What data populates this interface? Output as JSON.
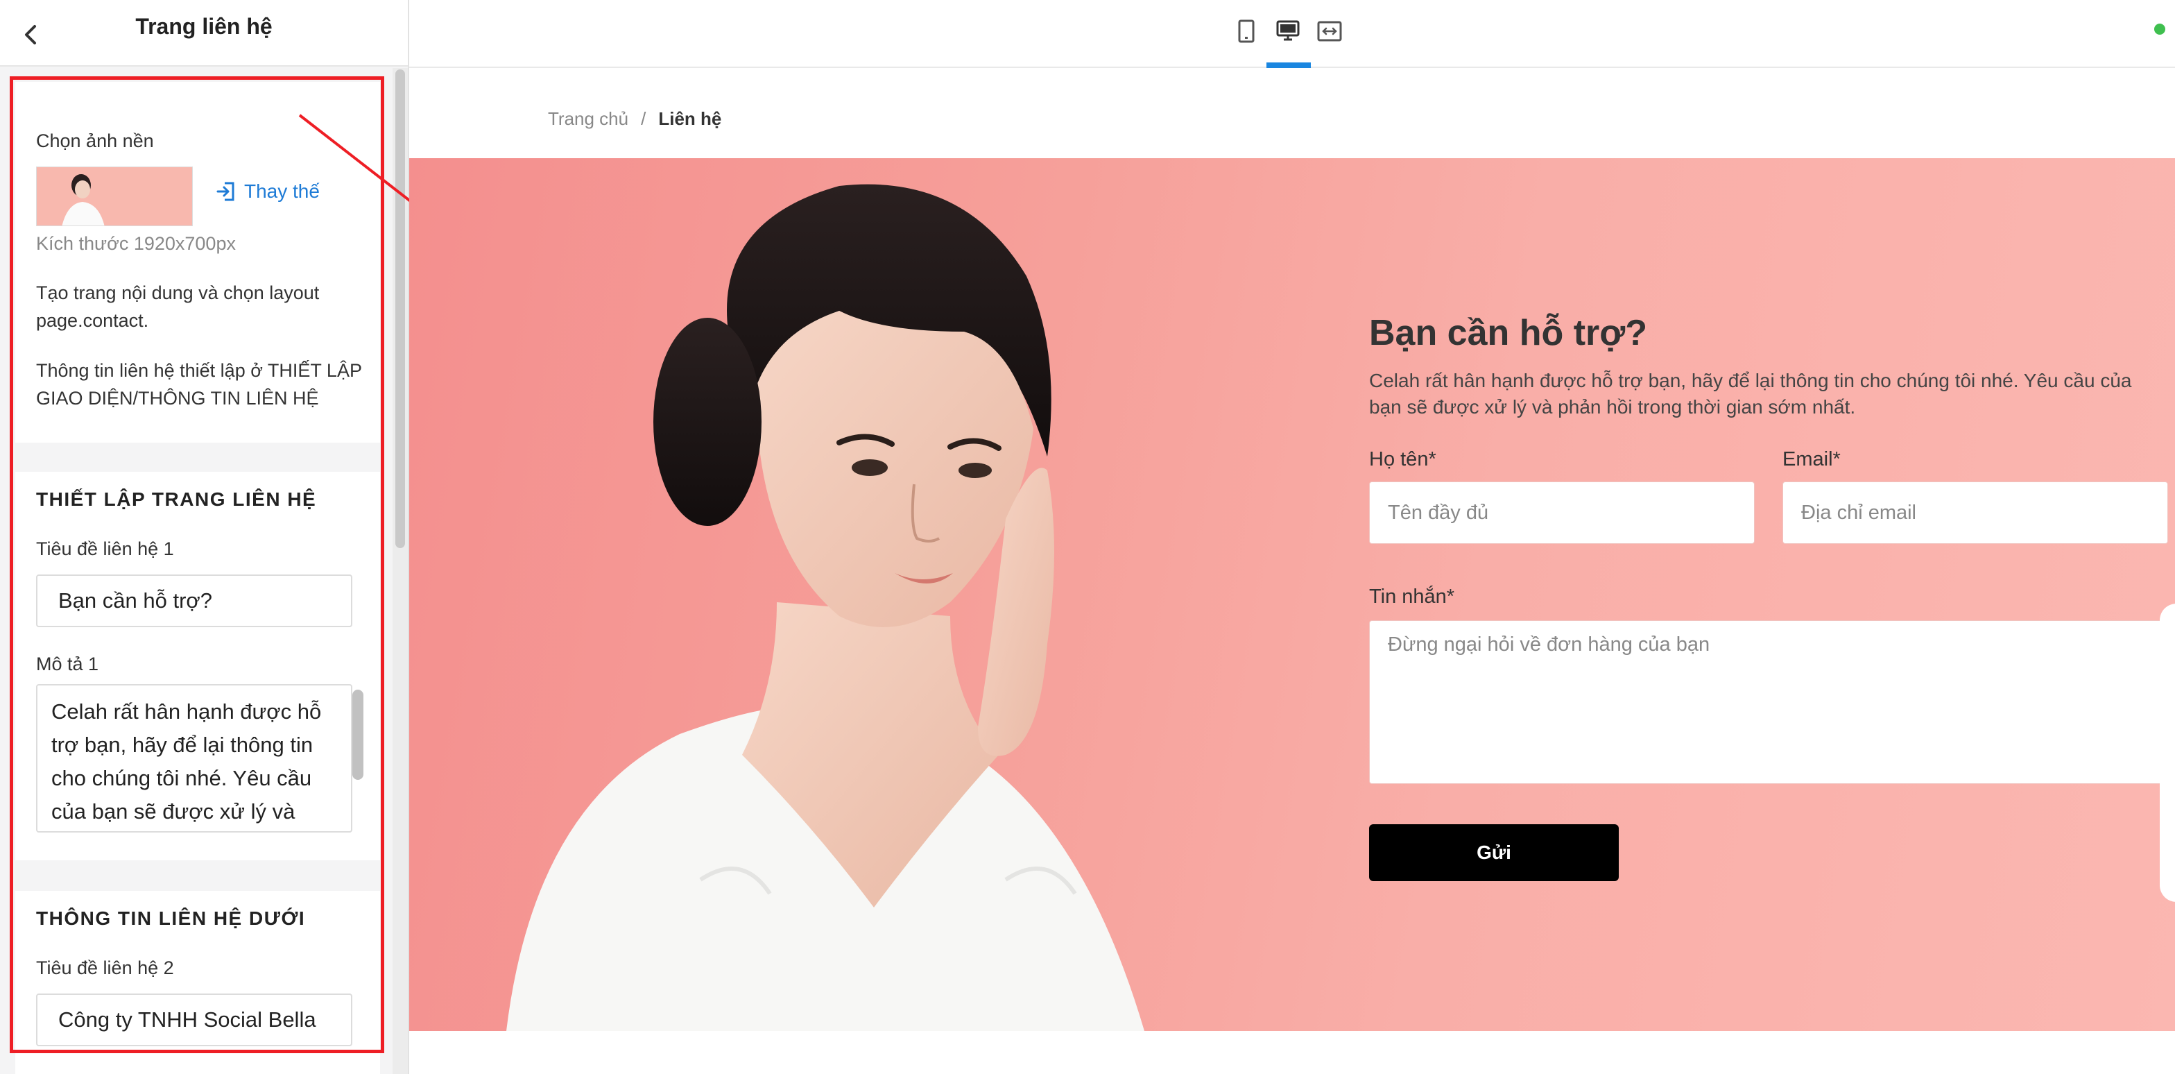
{
  "sidebar": {
    "title": "Trang liên hệ",
    "background_section": {
      "label": "Chọn ảnh nền",
      "replace_label": "Thay thế",
      "size_note": "Kích thước 1920x700px",
      "note_layout": "Tạo trang nội dung và chọn layout page.contact.",
      "note_contact_info": "Thông tin liên hệ thiết lập ở THIẾT LẬP GIAO DIỆN/THÔNG TIN LIÊN HỆ"
    },
    "contact_page_section": {
      "heading": "THIẾT LẬP TRANG LIÊN HỆ",
      "title1_label": "Tiêu đề liên hệ 1",
      "title1_value": "Bạn cần hỗ trợ?",
      "desc1_label": "Mô tả 1",
      "desc1_value": "Celah rất hân hạnh được hỗ trợ bạn, hãy để lại thông tin cho chúng tôi nhé. Yêu cầu của bạn sẽ được xử lý và phản hồi trong thời gian sớm nhất."
    },
    "bottom_contact_section": {
      "heading": "THÔNG TIN LIÊN HỆ DƯỚI",
      "title2_label": "Tiêu đề liên hệ 2",
      "title2_value": "Công ty TNHH Social Bella"
    }
  },
  "toolbar": {
    "devices": [
      "mobile-icon",
      "desktop-icon",
      "fullwidth-icon"
    ],
    "active_device": "desktop-icon"
  },
  "preview": {
    "breadcrumb": {
      "home": "Trang chủ",
      "separator": "/",
      "current": "Liên hệ"
    },
    "form": {
      "title": "Bạn cần hỗ trợ?",
      "description": "Celah rất hân hạnh được hỗ trợ bạn, hãy để lại thông tin cho chúng tôi nhé. Yêu cầu của bạn sẽ được xử lý và phản hồi trong thời gian sớm nhất.",
      "name_label": "Họ tên*",
      "name_placeholder": "Tên đầy đủ",
      "email_label": "Email*",
      "email_placeholder": "Địa chỉ email",
      "message_label": "Tin nhắn*",
      "message_placeholder": "Đừng ngại hỏi về đơn hàng của bạn",
      "submit_label": "Gửi"
    }
  },
  "colors": {
    "highlight": "#ee1e25",
    "accent": "#1a86e0",
    "link": "#1e7bd6",
    "hero_bg": "#f7a39d",
    "button": "#000000",
    "status": "#3fbf4f"
  }
}
